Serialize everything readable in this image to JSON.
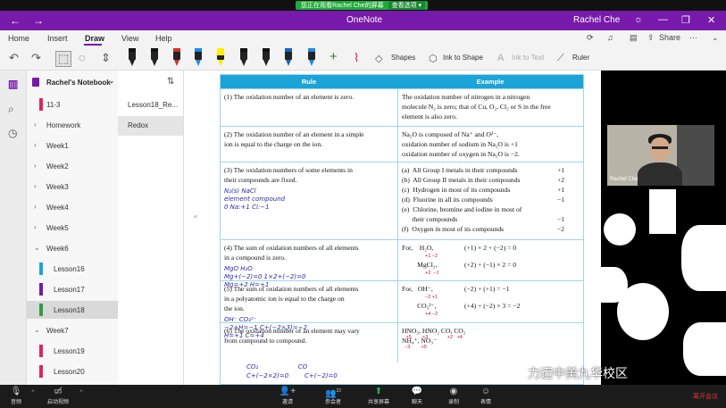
{
  "share_bar": {
    "status": "您正在观看Rachel Che的屏幕",
    "options": "查看选项 ▾"
  },
  "titlebar": {
    "app_title": "OneNote",
    "user": "Rachel Che"
  },
  "ribbon": {
    "tabs": [
      "Home",
      "Insert",
      "Draw",
      "View",
      "Help"
    ],
    "active_tab": "Draw",
    "share_label": "Share"
  },
  "toolbar": {
    "shapes": "Shapes",
    "ink_to_shape": "Ink to Shape",
    "ink_to_text": "Ink to Text",
    "ruler": "Ruler",
    "pen_colors": [
      "#111111",
      "#111111",
      "#d32f2f",
      "#1e88e5",
      "#ffee00",
      "#111111",
      "#111111",
      "#1565c0",
      "#1e88e5",
      "#2e7d32"
    ]
  },
  "notebook": {
    "name": "Rachel's Notebook",
    "sections": [
      {
        "label": "11-3",
        "type": "tagged",
        "color": "#e0245e"
      },
      {
        "label": "Homework",
        "type": "group"
      },
      {
        "label": "Week1",
        "type": "group"
      },
      {
        "label": "Week2",
        "type": "group"
      },
      {
        "label": "Week3",
        "type": "group"
      },
      {
        "label": "Week4",
        "type": "group"
      },
      {
        "label": "Week5",
        "type": "group"
      },
      {
        "label": "Week6",
        "type": "group-open"
      },
      {
        "label": "Lesson16",
        "type": "tagged",
        "color": "#1aa4d8"
      },
      {
        "label": "Lesson17",
        "type": "tagged",
        "color": "#7719aa"
      },
      {
        "label": "Lesson18",
        "type": "tagged",
        "color": "#2e9e44",
        "selected": true
      },
      {
        "label": "Week7",
        "type": "group-open"
      },
      {
        "label": "Lesson19",
        "type": "tagged",
        "color": "#e0245e"
      },
      {
        "label": "Lesson20",
        "type": "tagged",
        "color": "#e0245e"
      }
    ]
  },
  "pages": [
    {
      "label": "Lesson18_Re..."
    },
    {
      "label": "Redox",
      "selected": true
    }
  ],
  "table": {
    "header": {
      "rule": "Rule",
      "example": "Example"
    },
    "rows": [
      {
        "rule_lines": [
          "(1)  The oxidation number of an element is zero."
        ],
        "example_lines": [
          "The oxidation number of nitrogen in a nitrogen",
          "molecule N₂ is zero; that of Cu, O₂, Cl₂ or S in the free",
          "element is also zero."
        ]
      },
      {
        "rule_lines": [
          "(2)  The oxidation number of an element in a simple",
          "      ion is equal to the charge on the ion."
        ],
        "example_lines": [
          "Na₂O is composed of Na⁺ and O²⁻,",
          "oxidation number of sodium in Na₂O is +1",
          "oxidation number of oxygen in Na₂O is −2."
        ]
      },
      {
        "rule_lines": [
          "(3)  The oxidation numbers of some elements in",
          "      their compounds are fixed."
        ],
        "handwriting": [
          "N₂(s)          NaCl",
          "element       compound",
          "   0           Na:+1  Cl:−1"
        ],
        "examples_list": [
          {
            "text": "(a)  All Group I metals in their compounds",
            "value": "+1"
          },
          {
            "text": "(b)  All Group II metals in their compounds",
            "value": "+2"
          },
          {
            "text": "(c)  Hydrogen in most of its compounds",
            "value": "+1"
          },
          {
            "text": "(d)  Fluorine in all its compounds",
            "value": "−1"
          },
          {
            "text": "(e)  Chlorine, bromine and iodine in most of",
            "value": ""
          },
          {
            "text": "      their compounds",
            "value": "−1"
          },
          {
            "text": "(f)  Oxygen in most of its compounds",
            "value": "−2"
          }
        ]
      },
      {
        "rule_lines": [
          "(4)  The sum of oxidation numbers of all elements",
          "      in a compound is zero."
        ],
        "handwriting": [
          "MgO          H₂O",
          "Mg+(−2)=0    1×2+(−2)=0",
          "Mg=+2          H=+1"
        ],
        "eq_lines": [
          {
            "formula": "For,    H₂O,",
            "ox": "+1 −2",
            "calc": "(+1) × 2 + (−2) = 0"
          },
          {
            "formula": "         MgCl₂,",
            "ox": "+2  −1",
            "calc": "(+2) + (−1) × 2 = 0"
          }
        ]
      },
      {
        "rule_lines": [
          "(5)  The sum of oxidation numbers of all elements",
          "      in a polyatomic ion is equal to the charge on",
          "      the ion."
        ],
        "handwriting": [
          "OH⁻        CO₃²⁻",
          "−2+H=−1    C+(−2×3)=−2",
          "H=+1          C=+4"
        ],
        "eq_lines": [
          {
            "formula": "For,   OH⁻,",
            "ox": "−2 +1",
            "calc": "(−2) + (+1) = −1"
          },
          {
            "formula": "         CO₃²⁻,",
            "ox": "+4 −2",
            "calc": "(+4) + (−2) × 3 = −2"
          }
        ]
      },
      {
        "rule_lines": [
          "(6)  The oxidation number of an element may vary",
          "      from compound to compound."
        ],
        "example_lines": [
          "HNO₃, HNO₂          CO, CO₂",
          "NH₄⁺, NO₃⁻"
        ],
        "ox_lines": [
          "   +5        +3              +2   +4",
          "  −3        +5"
        ]
      }
    ],
    "below_handwriting": [
      "CO₂                    CO",
      "C+(−2×2)=0        C+(−2)=0"
    ]
  },
  "video": {
    "participant_name": "Rachel Che"
  },
  "meeting_bar": {
    "items": [
      {
        "label": "音频",
        "icon": "microphone-icon"
      },
      {
        "label": "启动视频",
        "icon": "video-off-icon"
      },
      {
        "label": "邀请",
        "icon": "invite-icon"
      },
      {
        "label": "参会者",
        "icon": "participants-icon",
        "badge": "22"
      },
      {
        "label": "共享屏幕",
        "icon": "share-screen-icon"
      },
      {
        "label": "聊天",
        "icon": "chat-icon"
      },
      {
        "label": "录制",
        "icon": "record-icon"
      },
      {
        "label": "表情",
        "icon": "emoji-icon"
      }
    ],
    "leave": "离开会议"
  },
  "watermark": "力迈中美九华校区"
}
